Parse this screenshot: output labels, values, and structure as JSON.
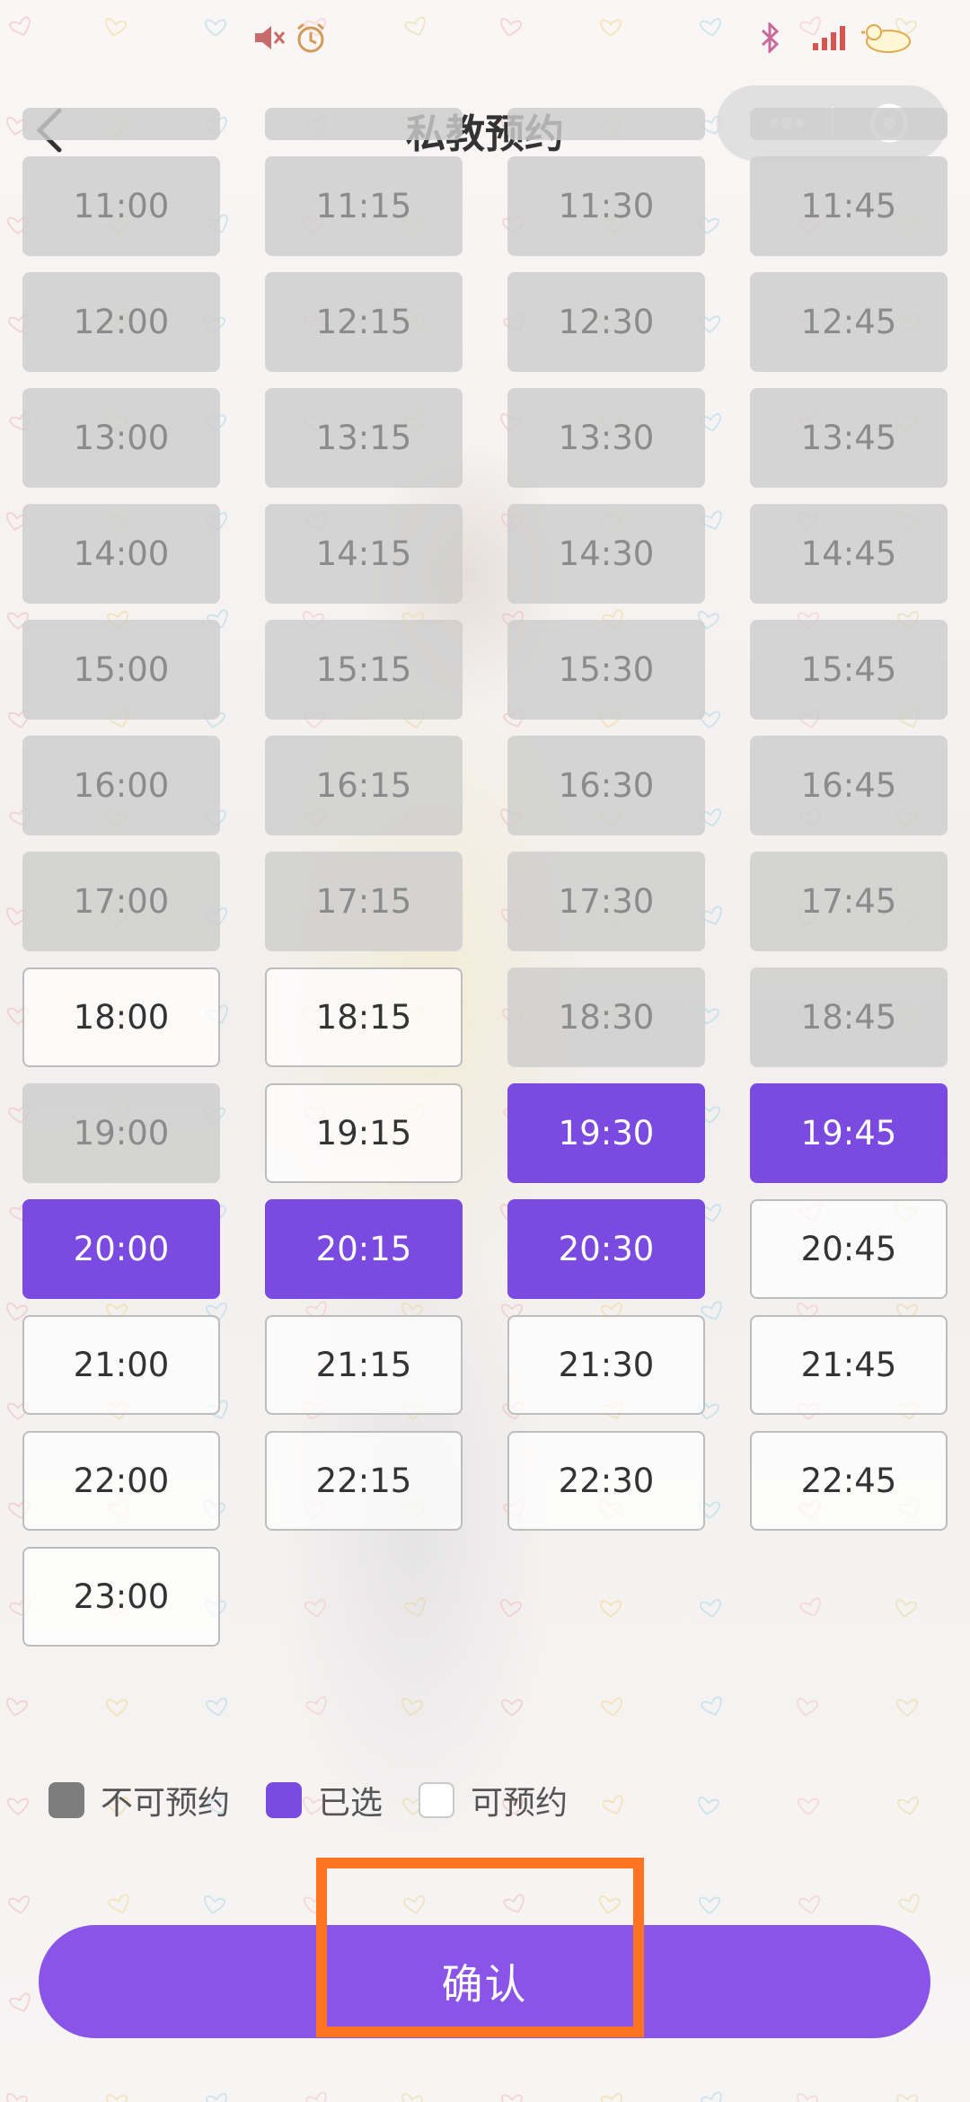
{
  "status_bar": {
    "left_icons": [
      "mute-icon",
      "alarm-icon"
    ],
    "right_icons": [
      "bluetooth-icon",
      "signal-icon",
      "battery-icon"
    ]
  },
  "header": {
    "title": "私教预约"
  },
  "slots": [
    {
      "time": "",
      "state": "unavailable"
    },
    {
      "time": "",
      "state": "unavailable"
    },
    {
      "time": "",
      "state": "unavailable"
    },
    {
      "time": "",
      "state": "unavailable"
    },
    {
      "time": "11:00",
      "state": "unavailable"
    },
    {
      "time": "11:15",
      "state": "unavailable"
    },
    {
      "time": "11:30",
      "state": "unavailable"
    },
    {
      "time": "11:45",
      "state": "unavailable"
    },
    {
      "time": "12:00",
      "state": "unavailable"
    },
    {
      "time": "12:15",
      "state": "unavailable"
    },
    {
      "time": "12:30",
      "state": "unavailable"
    },
    {
      "time": "12:45",
      "state": "unavailable"
    },
    {
      "time": "13:00",
      "state": "unavailable"
    },
    {
      "time": "13:15",
      "state": "unavailable"
    },
    {
      "time": "13:30",
      "state": "unavailable"
    },
    {
      "time": "13:45",
      "state": "unavailable"
    },
    {
      "time": "14:00",
      "state": "unavailable"
    },
    {
      "time": "14:15",
      "state": "unavailable"
    },
    {
      "time": "14:30",
      "state": "unavailable"
    },
    {
      "time": "14:45",
      "state": "unavailable"
    },
    {
      "time": "15:00",
      "state": "unavailable"
    },
    {
      "time": "15:15",
      "state": "unavailable"
    },
    {
      "time": "15:30",
      "state": "unavailable"
    },
    {
      "time": "15:45",
      "state": "unavailable"
    },
    {
      "time": "16:00",
      "state": "unavailable"
    },
    {
      "time": "16:15",
      "state": "unavailable"
    },
    {
      "time": "16:30",
      "state": "unavailable"
    },
    {
      "time": "16:45",
      "state": "unavailable"
    },
    {
      "time": "17:00",
      "state": "unavailable"
    },
    {
      "time": "17:15",
      "state": "unavailable"
    },
    {
      "time": "17:30",
      "state": "unavailable"
    },
    {
      "time": "17:45",
      "state": "unavailable"
    },
    {
      "time": "18:00",
      "state": "available"
    },
    {
      "time": "18:15",
      "state": "available"
    },
    {
      "time": "18:30",
      "state": "unavailable"
    },
    {
      "time": "18:45",
      "state": "unavailable"
    },
    {
      "time": "19:00",
      "state": "unavailable"
    },
    {
      "time": "19:15",
      "state": "available"
    },
    {
      "time": "19:30",
      "state": "selected"
    },
    {
      "time": "19:45",
      "state": "selected"
    },
    {
      "time": "20:00",
      "state": "selected"
    },
    {
      "time": "20:15",
      "state": "selected"
    },
    {
      "time": "20:30",
      "state": "selected"
    },
    {
      "time": "20:45",
      "state": "available"
    },
    {
      "time": "21:00",
      "state": "available"
    },
    {
      "time": "21:15",
      "state": "available"
    },
    {
      "time": "21:30",
      "state": "available"
    },
    {
      "time": "21:45",
      "state": "available"
    },
    {
      "time": "22:00",
      "state": "available"
    },
    {
      "time": "22:15",
      "state": "available"
    },
    {
      "time": "22:30",
      "state": "available"
    },
    {
      "time": "22:45",
      "state": "available"
    },
    {
      "time": "23:00",
      "state": "available"
    }
  ],
  "legend": {
    "unavailable": "不可预约",
    "selected": "已选",
    "available": "可预约"
  },
  "confirm_label": "确认",
  "colors": {
    "accent": "#7b4ae0",
    "confirm": "#8a54e8",
    "highlight": "#ff7420"
  }
}
